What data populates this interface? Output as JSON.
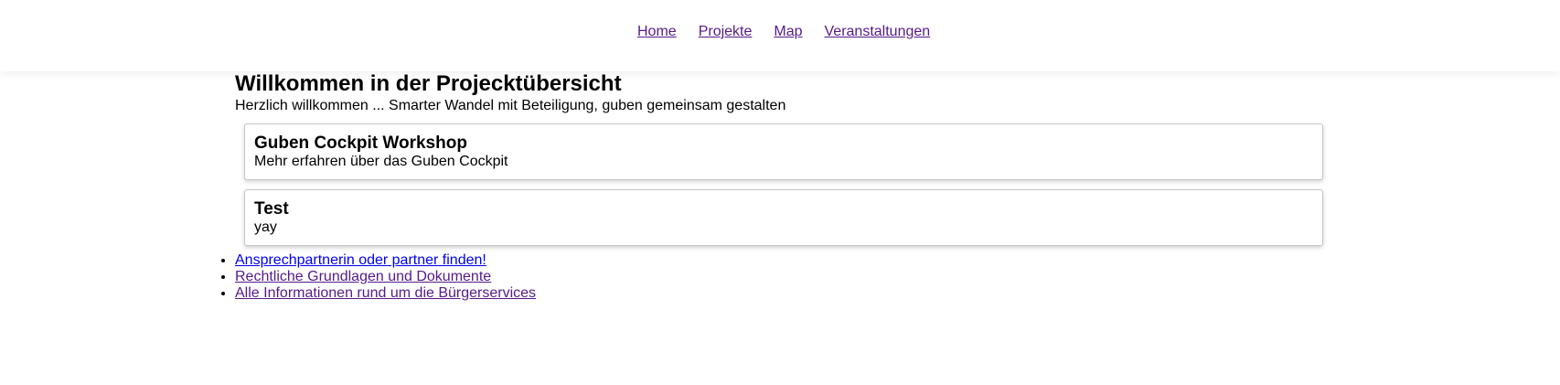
{
  "nav": {
    "items": [
      {
        "label": "Home",
        "color": "#551a8b"
      },
      {
        "label": "Projekte",
        "color": "#551a8b"
      },
      {
        "label": "Map",
        "color": "#551a8b"
      },
      {
        "label": "Veranstaltungen",
        "color": "#551a8b"
      }
    ]
  },
  "main": {
    "title": "Willkommen in der Projecktübersicht",
    "intro": "Herzlich willkommen ... Smarter Wandel mit Beteiligung, guben gemeinsam gestalten",
    "cards": [
      {
        "title": "Guben Cockpit Workshop",
        "description": "Mehr erfahren über das Guben Cockpit"
      },
      {
        "title": "Test",
        "description": "yay"
      }
    ]
  },
  "links": [
    {
      "label": "Ansprechpartnerin oder partner finden!",
      "color": "#0000ee"
    },
    {
      "label": "Rechtliche Grundlagen und Dokumente",
      "color": "#551a8b"
    },
    {
      "label": "Alle Informationen rund um die Bürgerservices",
      "color": "#551a8b"
    }
  ]
}
